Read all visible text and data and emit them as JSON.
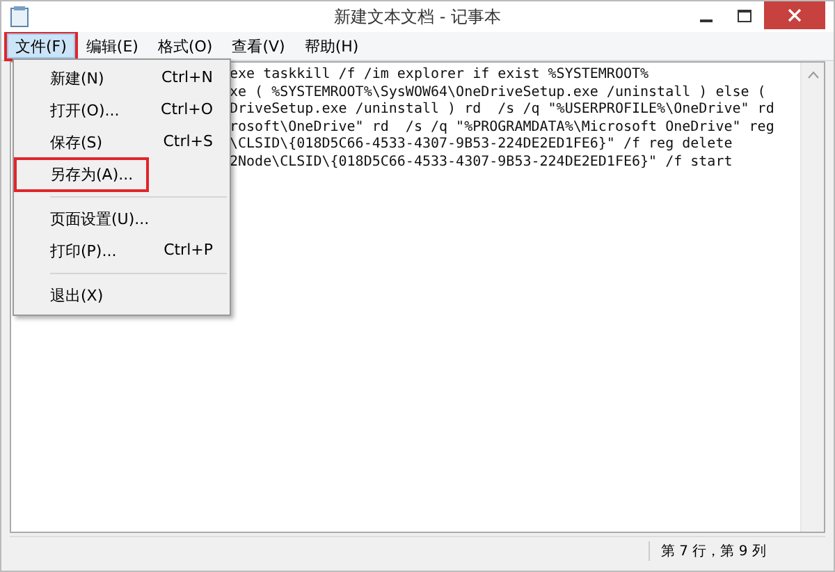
{
  "window": {
    "title": "新建文本文档 - 记事本"
  },
  "menu_bar": [
    {
      "label": "文件(F)",
      "selected": true,
      "highlighted": true
    },
    {
      "label": "编辑(E)",
      "selected": false,
      "highlighted": false
    },
    {
      "label": "格式(O)",
      "selected": false,
      "highlighted": false
    },
    {
      "label": "查看(V)",
      "selected": false,
      "highlighted": false
    },
    {
      "label": "帮助(H)",
      "selected": false,
      "highlighted": false
    }
  ],
  "file_menu": [
    {
      "kind": "item",
      "label": "新建(N)",
      "shortcut": "Ctrl+N",
      "highlighted": false
    },
    {
      "kind": "item",
      "label": "打开(O)...",
      "shortcut": "Ctrl+O",
      "highlighted": false
    },
    {
      "kind": "item",
      "label": "保存(S)",
      "shortcut": "Ctrl+S",
      "highlighted": false
    },
    {
      "kind": "item",
      "label": "另存为(A)...",
      "highlighted": true
    },
    {
      "kind": "separator"
    },
    {
      "kind": "item",
      "label": "页面设置(U)...",
      "highlighted": false
    },
    {
      "kind": "item",
      "label": "打印(P)...",
      "shortcut": "Ctrl+P",
      "highlighted": false
    },
    {
      "kind": "separator"
    },
    {
      "kind": "item",
      "label": "退出(X)",
      "highlighted": false
    }
  ],
  "editor": {
    "lines": [
      "exe taskkill /f /im explorer if exist %SYSTEMROOT%",
      "xe ( %SYSTEMROOT%\\SysWOW64\\OneDriveSetup.exe /uninstall ) else (",
      "DriveSetup.exe /uninstall ) rd  /s /q \"%USERPROFILE%\\OneDrive\" rd",
      "rosoft\\OneDrive\" rd  /s /q \"%PROGRAMDATA%\\Microsoft OneDrive\" reg",
      "\\CLSID\\{018D5C66-4533-4307-9B53-224DE2ED1FE6}\" /f reg delete",
      "2Node\\CLSID\\{018D5C66-4533-4307-9B53-224DE2ED1FE6}\" /f start"
    ]
  },
  "status_bar": {
    "position": "第 7 行，第 9 列"
  }
}
